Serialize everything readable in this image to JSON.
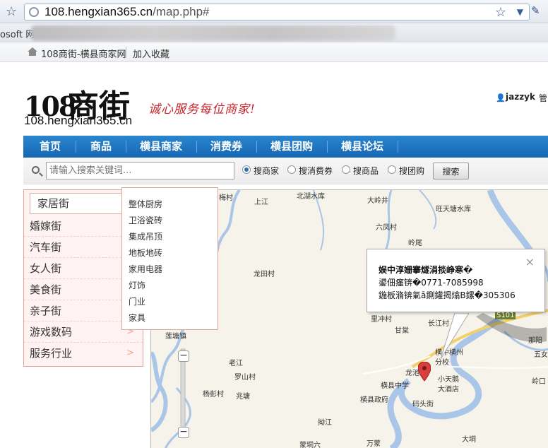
{
  "browser": {
    "url_domain": "108.hengxian365.cn",
    "url_path": "/map.php#",
    "bookmark_partial": "osoft 网",
    "favorites": [
      {
        "label": "108商街-横县商家网"
      },
      {
        "label": "加入收藏"
      }
    ]
  },
  "header": {
    "logo_number": "108",
    "logo_chars": "商街",
    "logo_domain": "108.hengxian365.cn",
    "slogan": "诚心服务每位商家!",
    "username": "jazzyk",
    "user_more": "管"
  },
  "nav": {
    "items": [
      {
        "label": "首页"
      },
      {
        "label": "商品"
      },
      {
        "label": "横县商家"
      },
      {
        "label": "消费券"
      },
      {
        "label": "横县团购"
      },
      {
        "label": "横县论坛"
      }
    ]
  },
  "search": {
    "placeholder": "请输入搜索关键词...",
    "options": [
      {
        "label": "搜商家",
        "checked": true
      },
      {
        "label": "搜消费券",
        "checked": false
      },
      {
        "label": "搜商品",
        "checked": false
      },
      {
        "label": "搜团购",
        "checked": false
      }
    ],
    "button": "搜索"
  },
  "categories": {
    "active": "家居街",
    "items": [
      {
        "label": "婚嫁街"
      },
      {
        "label": "汽车街"
      },
      {
        "label": "女人街"
      },
      {
        "label": "美食街"
      },
      {
        "label": "亲子街"
      },
      {
        "label": "游戏数码"
      },
      {
        "label": "服务行业"
      }
    ],
    "arrow": ">"
  },
  "submenu": {
    "items": [
      "整体厨房",
      "卫浴瓷砖",
      "集成吊顶",
      "地板地砖",
      "家用电器",
      "灯饰",
      "门业",
      "家具"
    ]
  },
  "map": {
    "places": [
      {
        "label": "梅村"
      },
      {
        "label": "上江"
      },
      {
        "label": "北湖水库"
      },
      {
        "label": "大岭井"
      },
      {
        "label": "旺天塘水库"
      },
      {
        "label": "六凤村"
      },
      {
        "label": "岭尾"
      },
      {
        "label": "龙田村"
      },
      {
        "label": "里冲村"
      },
      {
        "label": "甘棠"
      },
      {
        "label": "长江村"
      },
      {
        "label": "S101"
      },
      {
        "label": "那阳"
      },
      {
        "label": "五女"
      },
      {
        "label": "岭口"
      },
      {
        "label": "莲塘镇"
      },
      {
        "label": "老江"
      },
      {
        "label": "罗山村"
      },
      {
        "label": "杨彭村"
      },
      {
        "label": "兆塘"
      },
      {
        "label": "横中横州分校"
      },
      {
        "label": "龙池"
      },
      {
        "label": "横县中学"
      },
      {
        "label": "小天鹅大酒店"
      },
      {
        "label": "横县政府"
      },
      {
        "label": "码头街"
      },
      {
        "label": "拗江"
      },
      {
        "label": "蒙垌六"
      },
      {
        "label": "万蒙"
      },
      {
        "label": "大垌"
      }
    ],
    "info": {
      "title": "娱中淳姗搴燧涓掞峥寒�",
      "phone": "鍙佃瘽锛�0771-7085998",
      "addr": "鍦板潃锛氭ā鍘鑵揭熻B鏍�305306",
      "close": "×"
    }
  }
}
